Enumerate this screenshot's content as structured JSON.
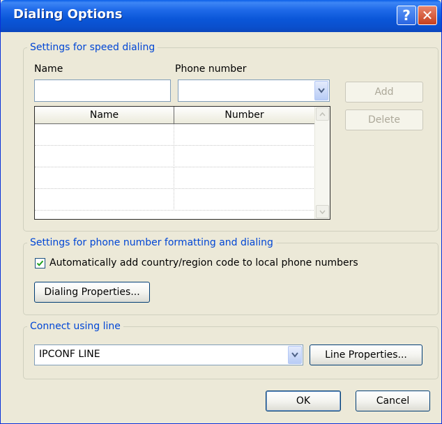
{
  "window": {
    "title": "Dialing Options"
  },
  "speed_dialing": {
    "legend": "Settings for speed dialing",
    "name_label": "Name",
    "phone_label": "Phone number",
    "name_value": "",
    "phone_value": "",
    "add_label": "Add",
    "delete_label": "Delete",
    "columns": [
      "Name",
      "Number"
    ],
    "rows": []
  },
  "formatting": {
    "legend": "Settings for phone number formatting and dialing",
    "auto_country_label": "Automatically add country/region code to local phone numbers",
    "auto_country_checked": true,
    "dialing_properties_label": "Dialing Properties..."
  },
  "connect": {
    "legend": "Connect using line",
    "line_value": "IPCONF LINE",
    "line_properties_label": "Line Properties..."
  },
  "footer": {
    "ok_label": "OK",
    "cancel_label": "Cancel"
  },
  "icons": {
    "help": "help-icon",
    "close": "close-icon",
    "dropdown": "chevron-down-icon",
    "scroll_up": "scroll-up-icon",
    "scroll_down": "scroll-down-icon",
    "check": "checkmark-icon"
  }
}
